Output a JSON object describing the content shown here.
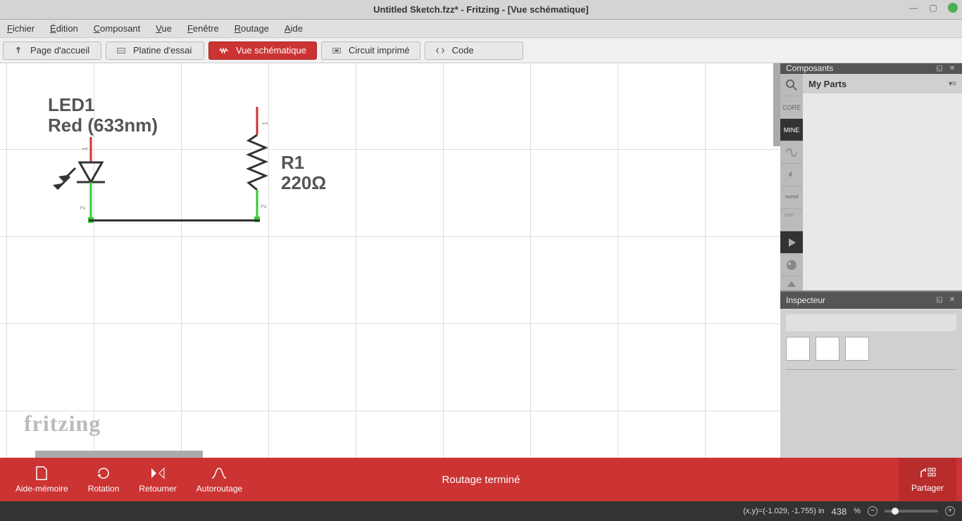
{
  "titlebar": {
    "title": "Untitled Sketch.fzz* - Fritzing - [Vue schématique]"
  },
  "menu": {
    "file": "Fichier",
    "edit": "Édition",
    "component": "Composant",
    "view": "Vue",
    "window": "Fenêtre",
    "routing": "Routage",
    "help": "Aide"
  },
  "views": {
    "home": "Page d'accueil",
    "breadboard": "Platine d'essai",
    "schematic": "Vue schématique",
    "pcb": "Circuit imprimé",
    "code": "Code"
  },
  "canvas": {
    "led": {
      "ref": "LED1",
      "desc": "Red (633nm)",
      "pin1": "1",
      "pin2": "2"
    },
    "resistor": {
      "ref": "R1",
      "value": "220Ω",
      "pin1": "1",
      "pin2": "2"
    },
    "watermark": "fritzing"
  },
  "panels": {
    "components": {
      "title": "Composants",
      "parts_title": "My Parts",
      "tabs": {
        "core": "CORE",
        "mine": "MINE",
        "seeed": "seeed"
      }
    },
    "inspector": {
      "title": "Inspecteur"
    }
  },
  "toolbar": {
    "memo": "Aide-mémoire",
    "rotate": "Rotation",
    "flip": "Retourner",
    "autoroute": "Autoroutage",
    "status": "Routage terminé",
    "share": "Partager"
  },
  "status": {
    "coords": "(x,y)=(-1.029, -1.755) in",
    "zoom_value": "438",
    "zoom_unit": "%"
  }
}
